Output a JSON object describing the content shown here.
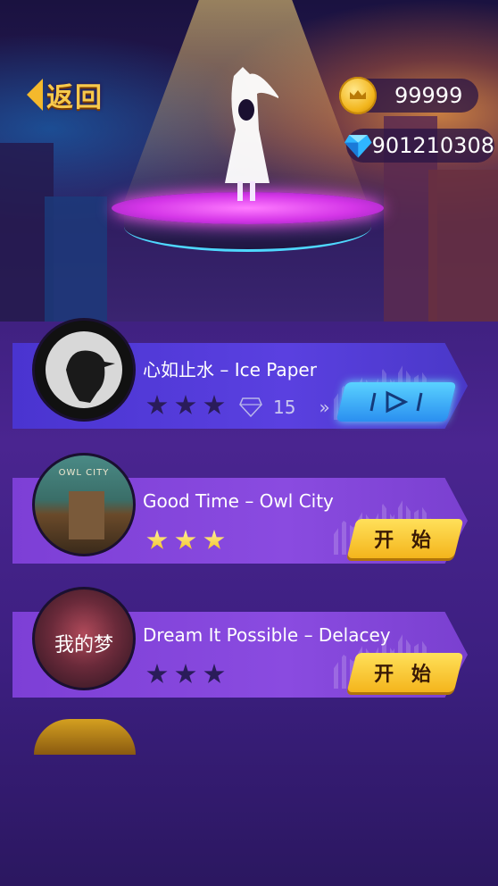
{
  "header": {
    "back_label": "返回",
    "coins": "99999",
    "gems": "901210308"
  },
  "songs": [
    {
      "title": "心如止水  – Ice Paper",
      "stars": 3,
      "stars_earned": 0,
      "cost": "15",
      "locked": true,
      "action": "play"
    },
    {
      "title": "Good Time – Owl City",
      "stars": 3,
      "stars_earned": 3,
      "album_text": "OWL CITY",
      "start_label": "开 始"
    },
    {
      "title": "Dream It Possible – Delacey",
      "stars": 3,
      "stars_earned": 0,
      "album_text": "我的梦",
      "start_label": "开 始"
    }
  ],
  "colors": {
    "card_blue": "#4a34d0",
    "card_purple": "#7d3fd6",
    "gold": "#f4b51c",
    "cyan": "#2a8ff0"
  }
}
